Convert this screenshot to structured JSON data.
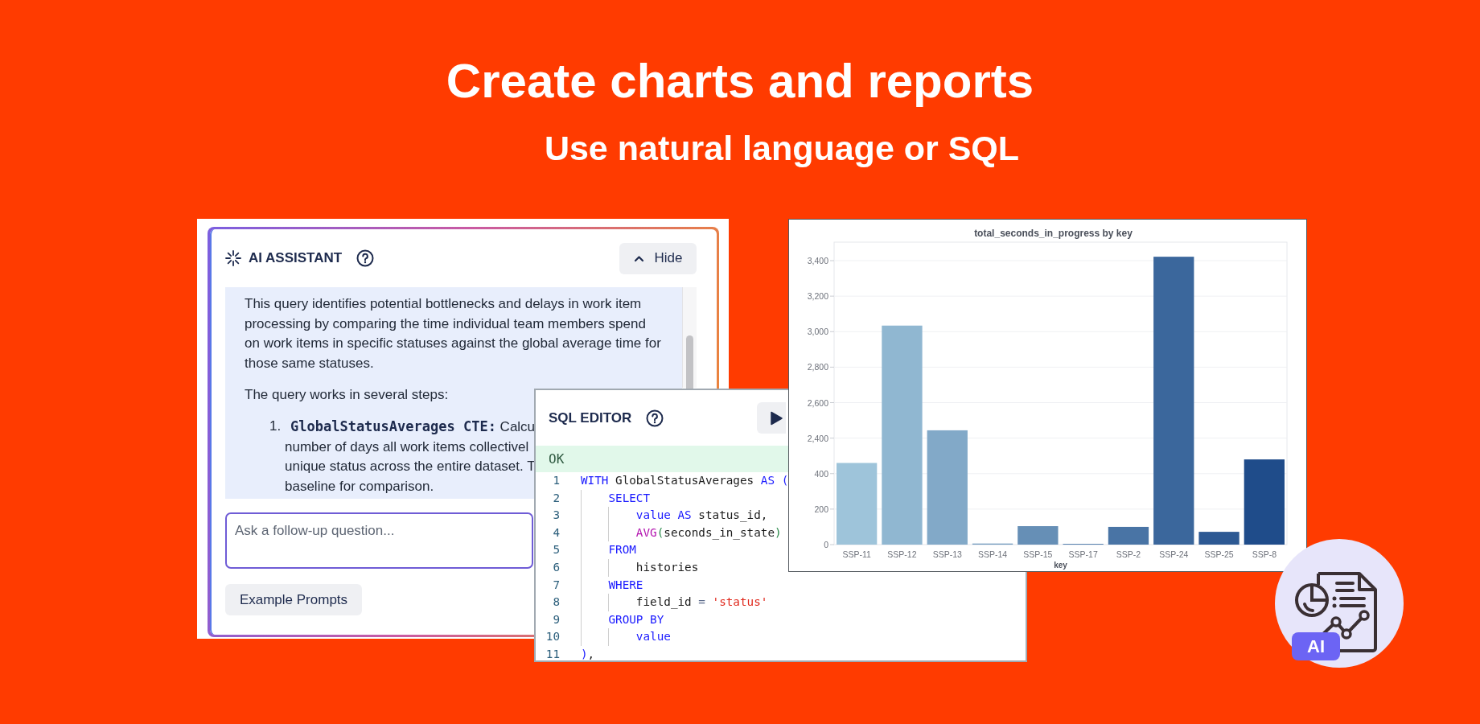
{
  "headline": {
    "title": "Create charts and reports",
    "subtitle": "Use natural language or SQL"
  },
  "ai_assistant": {
    "title": "AI ASSISTANT",
    "hide_button": "Hide",
    "paragraphs": [
      "This query identifies potential bottlenecks and delays in work item\nprocessing by comparing the time individual team members spend\non work items in specific statuses against the global average time for\nthose same statuses.",
      "The query works in several steps:"
    ],
    "steps": [
      {
        "number": "1.",
        "lines": [
          "**GlobalStatusAverages CTE:** Calcu",
          "number of days all work items collectivel",
          "unique status across the entire dataset. T",
          "baseline for comparison."
        ]
      }
    ],
    "input": {
      "placeholder": "Ask a follow-up question..."
    },
    "example_button": "Example Prompts"
  },
  "sql_editor": {
    "title": "SQL EDITOR",
    "status": "OK",
    "lines": [
      {
        "number": "1",
        "tokens": [
          {
            "kind": "kw",
            "text": "WITH"
          },
          {
            "kind": "id",
            "text": " GlobalStatusAverages "
          },
          {
            "kind": "kw",
            "text": "AS ("
          }
        ],
        "children": [
          {
            "number": "2",
            "tokens": [
              {
                "kind": "kw",
                "text": "SELECT"
              }
            ],
            "children": [
              {
                "number": "3",
                "tokens": [
                  {
                    "kind": "kw",
                    "text": "value AS"
                  },
                  {
                    "kind": "id",
                    "text": " status_id,"
                  }
                ]
              },
              {
                "number": "4",
                "tokens": [
                  {
                    "kind": "fn",
                    "text": "AVG"
                  },
                  {
                    "kind": "paren",
                    "text": "("
                  },
                  {
                    "kind": "id",
                    "text": "seconds_in_state"
                  },
                  {
                    "kind": "paren",
                    "text": ")"
                  }
                ]
              }
            ]
          },
          {
            "number": "5",
            "tokens": [
              {
                "kind": "kw",
                "text": "FROM"
              }
            ],
            "children": [
              {
                "number": "6",
                "tokens": [
                  {
                    "kind": "id",
                    "text": "histories"
                  }
                ]
              }
            ]
          },
          {
            "number": "7",
            "tokens": [
              {
                "kind": "kw",
                "text": "WHERE"
              }
            ],
            "children": [
              {
                "number": "8",
                "tokens": [
                  {
                    "kind": "id",
                    "text": "field_id "
                  },
                  {
                    "kind": "op",
                    "text": "="
                  },
                  {
                    "kind": "str",
                    "text": " 'status'"
                  }
                ]
              }
            ]
          },
          {
            "number": "9",
            "tokens": [
              {
                "kind": "kw",
                "text": "GROUP BY"
              }
            ],
            "children": [
              {
                "number": "10",
                "tokens": [
                  {
                    "kind": "kw",
                    "text": "value"
                  }
                ]
              }
            ]
          }
        ]
      },
      {
        "number": "11",
        "tokens": [
          {
            "kind": "kw",
            "text": ")"
          },
          {
            "kind": "id",
            "text": ","
          }
        ]
      }
    ]
  },
  "chart": {
    "title": "total_seconds_in_progress by key",
    "y_labels": [
      "3,400",
      "3,200",
      "3,000",
      "2,800",
      "2,600",
      "2,400",
      "400",
      "200",
      "0"
    ],
    "x_labels": [
      "SSP-11",
      "SSP-12",
      "SSP-13",
      "SSP-14",
      "SSP-15",
      "SSP-17",
      "SSP-2",
      "SSP-24",
      "SSP-25",
      "SSP-8"
    ],
    "x_title": "key"
  },
  "badge": {
    "label": "AI"
  }
}
